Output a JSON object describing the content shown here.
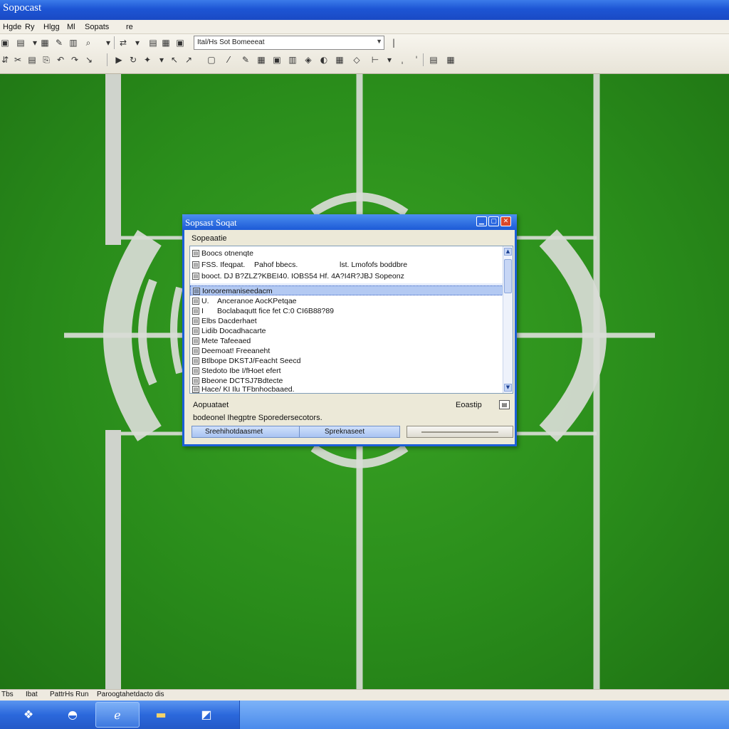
{
  "window": {
    "title": "Sopocast"
  },
  "menubar": {
    "items": [
      "Hgde",
      "Ry",
      "Hlgg",
      "Ml",
      "Sopats",
      "re"
    ]
  },
  "toolbar": {
    "address_text": "Ital/Hs Sot Bomeeeat"
  },
  "dialog": {
    "title": "Sopsast Soqat",
    "subtitle": "Sopeaatie",
    "rows": [
      {
        "c1": "Boocs otnenqte",
        "c2": "",
        "c3": ""
      },
      {
        "c1": "FSS. Ifeqpat.",
        "c2": "Pahof bbecs.",
        "c3": "lst.   Lmofofs boddbre"
      },
      {
        "c1": "booct. DJ B?ZLZ?KBEI40. IOBS54 Hf. 4A?I4R?JBJ Sopeonz",
        "c2": "",
        "c3": ""
      },
      {
        "c1": "Iorooremaniseedacm",
        "c2": "",
        "c3": ""
      },
      {
        "c1": "U.",
        "c2": "Anceranoe AocKPetqae",
        "c3": ""
      },
      {
        "c1": "I",
        "c2": "Boclabaqutt fice fet C:0 CI6B88?89",
        "c3": ""
      },
      {
        "c1": "Elbs  Dacderhaet",
        "c2": "",
        "c3": ""
      },
      {
        "c1": "Lidib  Docadhacarte",
        "c2": "",
        "c3": ""
      },
      {
        "c1": "Mete  Tafeeaed",
        "c2": "",
        "c3": ""
      },
      {
        "c1": "Deemoat! Freeaneht",
        "c2": "",
        "c3": ""
      },
      {
        "c1": "Btlbope DKSTJ/Feacht Seecd",
        "c2": "",
        "c3": ""
      },
      {
        "c1": "Stedoto  Ibe  I/fHoet efert",
        "c2": "",
        "c3": ""
      },
      {
        "c1": "Bbeone  DCTSJ7Bdtecte",
        "c2": "",
        "c3": ""
      },
      {
        "c1": "Hace/ KI   Ilu  TFbnhocbaaed.",
        "c2": "",
        "c3": ""
      }
    ],
    "label_left": "Aopuataet",
    "label_right": "Eoastip",
    "status_text": "bodeonel Ihegptre Sporedersecotors.",
    "progress": {
      "left_label": "Sreehihotdaasmet",
      "right_label": "Spreknaseet"
    }
  },
  "status_strip": {
    "items": [
      "Tbs",
      "Ibat",
      "PattrHs  Run",
      "Paroogtahetdacto dis"
    ]
  }
}
